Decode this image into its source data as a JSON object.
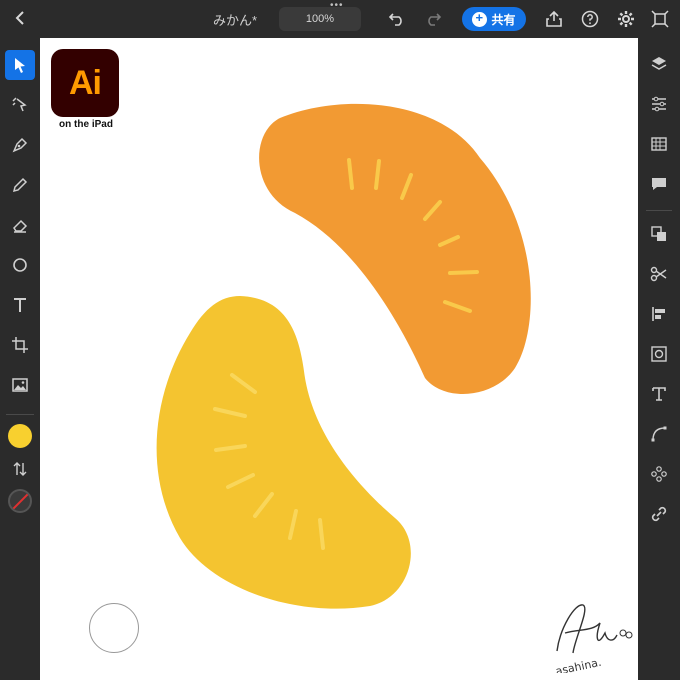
{
  "topbar": {
    "back_icon": "chevron-left-icon",
    "document_title": "みかん*",
    "zoom_level": "100%",
    "share_label": "共有",
    "icons": [
      "undo-icon",
      "redo-icon",
      "export-icon",
      "help-icon",
      "settings-icon",
      "fullscreen-icon"
    ]
  },
  "left_toolbar": {
    "tools": [
      "selection-tool-icon",
      "direct-selection-tool-icon",
      "pen-tool-icon",
      "pencil-tool-icon",
      "eraser-tool-icon",
      "ellipse-tool-icon",
      "type-tool-icon",
      "transform-tool-icon",
      "image-tool-icon"
    ],
    "fill_color": "#f8d02f",
    "stroke": "none"
  },
  "canvas": {
    "logo_text": "Ai",
    "logo_caption": "on the iPad",
    "signature_text": "asahina.",
    "colors": {
      "orange_segment": "#f29a33",
      "yellow_segment": "#f4c430",
      "orange_seed": "#f9c94a",
      "yellow_seed": "#f9d65a"
    }
  },
  "right_panel": {
    "icons": [
      "layers-icon",
      "properties-icon",
      "swatches-icon",
      "comments-icon",
      "arrange-icon",
      "cut-icon",
      "align-icon",
      "image-trace-icon",
      "type-panel-icon",
      "path-icon",
      "repeat-icon",
      "links-icon"
    ]
  }
}
